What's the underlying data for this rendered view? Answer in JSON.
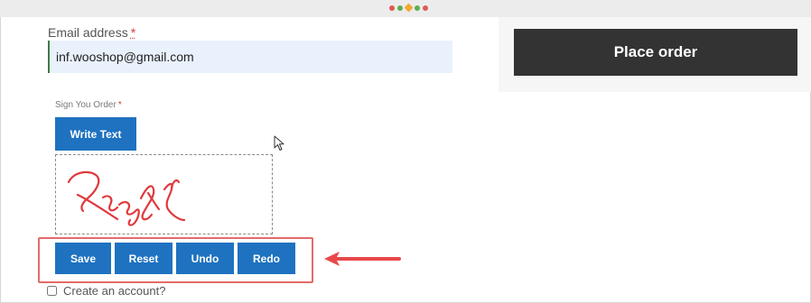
{
  "billing": {
    "email_label": "Email address",
    "required_mark": "*",
    "email_value": "inf.wooshop@gmail.com"
  },
  "order": {
    "place_order_label": "Place order"
  },
  "signature": {
    "label": "Sign You Order",
    "required_mark": "*",
    "write_text_label": "Write Text",
    "stroke_color": "#e0393e"
  },
  "signature_actions": {
    "save_label": "Save",
    "reset_label": "Reset",
    "undo_label": "Undo",
    "redo_label": "Redo"
  },
  "account": {
    "create_account_label": "Create an account?",
    "checked": false
  },
  "colors": {
    "button_blue": "#1e72c0",
    "place_order_bg": "#333333",
    "highlight_red": "#e46a6a",
    "email_field_bg": "#e9f1fd"
  },
  "icons": [
    "loading-dots-icon",
    "mouse-pointer-icon",
    "annotation-arrow-icon"
  ]
}
